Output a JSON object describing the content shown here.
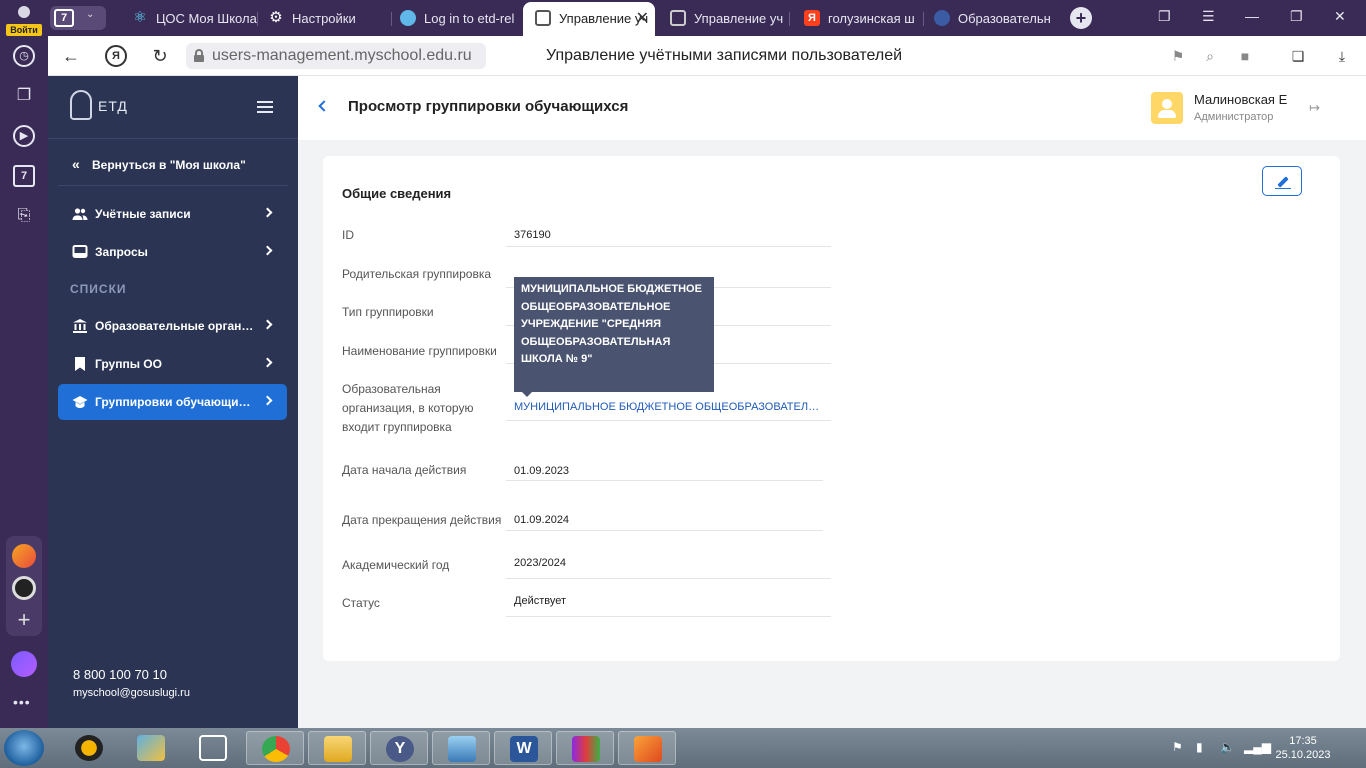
{
  "browser": {
    "login_label": "Войти",
    "tab_count": "7",
    "tabs": [
      {
        "title": "ЦОС Моя Школа",
        "icon": "atom-icon",
        "color": "#61dafb"
      },
      {
        "title": "Настройки",
        "icon": "gear-icon",
        "color": "#ffffff"
      },
      {
        "title": "Log in to etd-rel",
        "icon": "cloud-icon",
        "color": "#5fb8e8"
      },
      {
        "title": "Управление уч",
        "icon": "etd-icon",
        "color": "#555555"
      },
      {
        "title": "Управление уч",
        "icon": "etd-icon",
        "color": "#555555"
      },
      {
        "title": "голузинская ш",
        "icon": "yandex-icon",
        "color": "#fc3f1d"
      },
      {
        "title": "Образовательн",
        "icon": "emblem-icon",
        "color": "#3b5ba5"
      }
    ],
    "url": "users-management.myschool.edu.ru",
    "page_title": "Управление учётными записями пользователей",
    "yandex_letter": "Я",
    "side_box_num": "7"
  },
  "sidebar": {
    "logo_text": "ЕТД",
    "back_label": "Вернуться в \"Моя школа\"",
    "items_top": [
      {
        "label": "Учётные записи",
        "icon": "users-icon"
      },
      {
        "label": "Запросы",
        "icon": "inbox-icon"
      }
    ],
    "section_label": "СПИСКИ",
    "items_lists": [
      {
        "label": "Образовательные организации",
        "icon": "institution-icon"
      },
      {
        "label": "Группы ОО",
        "icon": "bookmark-icon"
      },
      {
        "label": "Группировки обучающихся",
        "icon": "graduation-cap-icon",
        "active": true
      }
    ],
    "phone": "8 800 100 70 10",
    "email": "myschool@gosuslugi.ru"
  },
  "header": {
    "title": "Просмотр группировки обучающихся",
    "user_name": "Малиновская Е",
    "user_role": "Администратор"
  },
  "card": {
    "heading": "Общие сведения",
    "fields": [
      {
        "label": "ID",
        "value": "376190"
      },
      {
        "label": "Родительская группировка",
        "value": ""
      },
      {
        "label": "Тип группировки",
        "value": ""
      },
      {
        "label": "Наименование группировки",
        "value": ""
      },
      {
        "label": "Образовательная организация, в которую входит группировка",
        "value": "МУНИЦИПАЛЬНОЕ БЮДЖЕТНОЕ ОБЩЕОБРАЗОВАТЕЛЬНОЕ УЧРЕЖДЕНИЕ \"СРЕДНЯЯ ОБЩЕОБРАЗОВАТЕЛЬНАЯ ШКОЛА № 9\""
      },
      {
        "label": "Дата начала действия",
        "value": "01.09.2023"
      },
      {
        "label": "Дата прекращения действия",
        "value": "01.09.2024"
      },
      {
        "label": "Академический год",
        "value": "2023/2024"
      },
      {
        "label": "Статус",
        "value": "Действует"
      }
    ],
    "tooltip": "МУНИЦИПАЛЬНОЕ БЮДЖЕТНОЕ ОБЩЕОБРАЗОВАТЕЛЬНОЕ УЧРЕЖДЕНИЕ \"СРЕДНЯЯ ОБЩЕОБРАЗОВАТЕЛЬНАЯ ШКОЛА № 9\""
  },
  "taskbar": {
    "time": "17:35",
    "date": "25.10.2023"
  }
}
